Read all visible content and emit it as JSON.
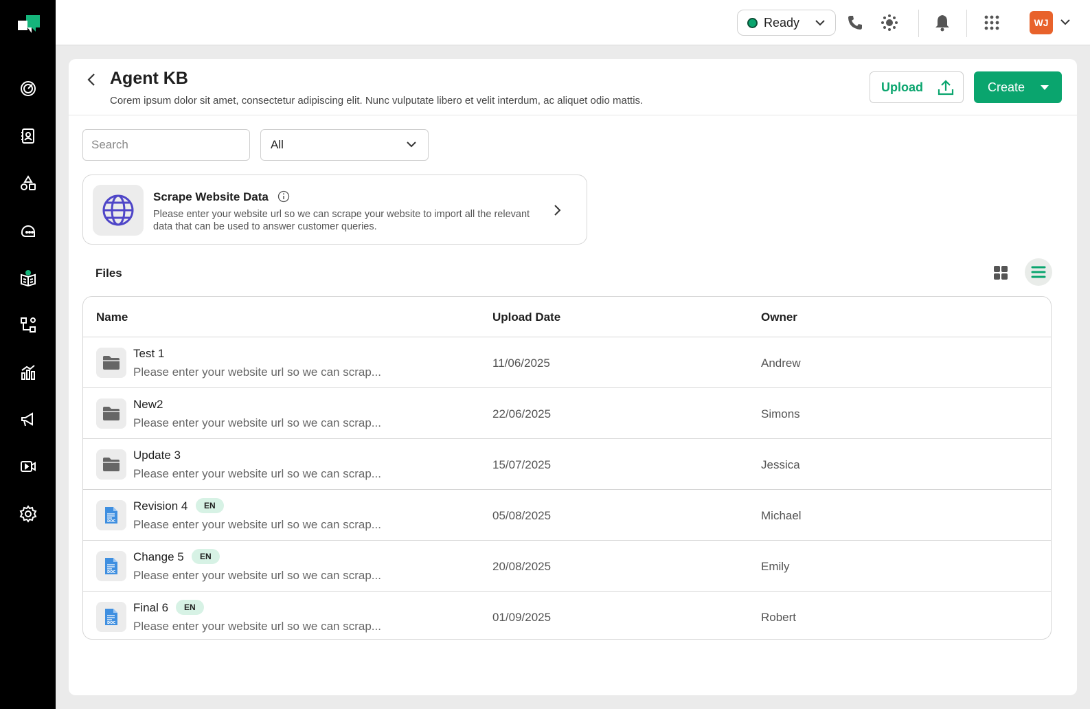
{
  "topbar": {
    "status": "Ready",
    "avatar_initials": "WJ"
  },
  "header": {
    "title": "Agent KB",
    "description": "Corem ipsum dolor sit amet, consectetur adipiscing elit. Nunc vulputate libero et velit interdum, ac aliquet odio mattis.",
    "upload_label": "Upload",
    "create_label": "Create"
  },
  "filters": {
    "search_placeholder": "Search",
    "type_value": "All"
  },
  "scrape": {
    "title": "Scrape Website Data",
    "description": "Please enter your website url so we can scrape your website to import all the relevant data that can be used to answer customer queries."
  },
  "files": {
    "label": "Files",
    "columns": [
      "Name",
      "Upload Date",
      "Owner"
    ],
    "rows": [
      {
        "name": "Test 1",
        "desc": "Please enter your website url so we can scrap...",
        "date": "11/06/2025",
        "owner": "Andrew",
        "type": "folder"
      },
      {
        "name": "New2",
        "desc": "Please enter your website url so we can scrap...",
        "date": "22/06/2025",
        "owner": "Simons",
        "type": "folder"
      },
      {
        "name": "Update 3",
        "desc": "Please enter your website url so we can scrap...",
        "date": "15/07/2025",
        "owner": "Jessica",
        "type": "folder"
      },
      {
        "name": "Revision 4",
        "badge": "EN",
        "desc": "Please enter your website url so we can scrap...",
        "date": "05/08/2025",
        "owner": "Michael",
        "type": "doc"
      },
      {
        "name": "Change 5",
        "badge": "EN",
        "desc": "Please enter your website url so we can scrap...",
        "date": "20/08/2025",
        "owner": "Emily",
        "type": "doc"
      },
      {
        "name": "Final 6",
        "badge": "EN",
        "desc": "Please enter your website url so we can scrap...",
        "date": "01/09/2025",
        "owner": "Robert",
        "type": "doc"
      }
    ]
  },
  "colors": {
    "accent": "#0aa56e",
    "sidebar": "#000000",
    "avatar": "#e8622b",
    "badge": "#d7f2e5"
  }
}
